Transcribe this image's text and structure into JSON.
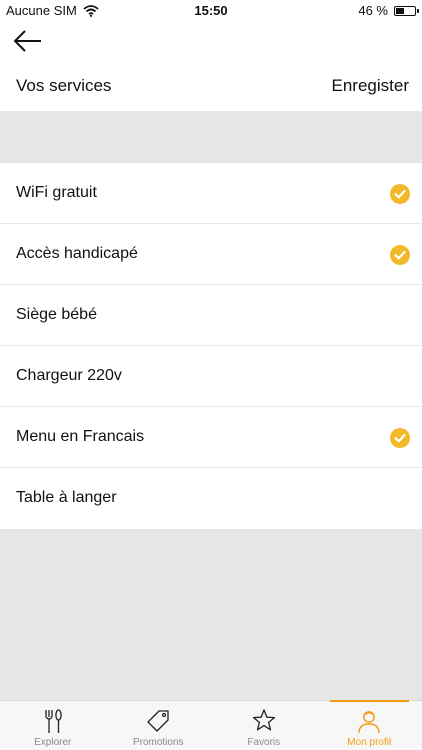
{
  "status_bar": {
    "carrier": "Aucune SIM",
    "time": "15:50",
    "battery_text": "46 %",
    "battery_level": 0.46
  },
  "header": {
    "back_icon": "arrow-left-icon",
    "title": "Vos services",
    "save_label": "Enregister"
  },
  "services": {
    "items": [
      {
        "label": "WiFi gratuit",
        "checked": true
      },
      {
        "label": "Accès handicapé",
        "checked": true
      },
      {
        "label": "Siège bébé",
        "checked": false
      },
      {
        "label": "Chargeur 220v",
        "checked": false
      },
      {
        "label": "Menu en Francais",
        "checked": true
      },
      {
        "label": "Table à langer",
        "checked": false
      }
    ]
  },
  "tabbar": {
    "tabs": [
      {
        "label": "Explorer",
        "icon": "fork-knife-icon",
        "active": false
      },
      {
        "label": "Promotions",
        "icon": "tag-icon",
        "active": false
      },
      {
        "label": "Favoris",
        "icon": "star-icon",
        "active": false
      },
      {
        "label": "Mon profil",
        "icon": "user-icon",
        "active": true
      }
    ]
  },
  "colors": {
    "accent": "#f39c12",
    "check": "#f2b92a",
    "background": "#e6e6e6"
  }
}
